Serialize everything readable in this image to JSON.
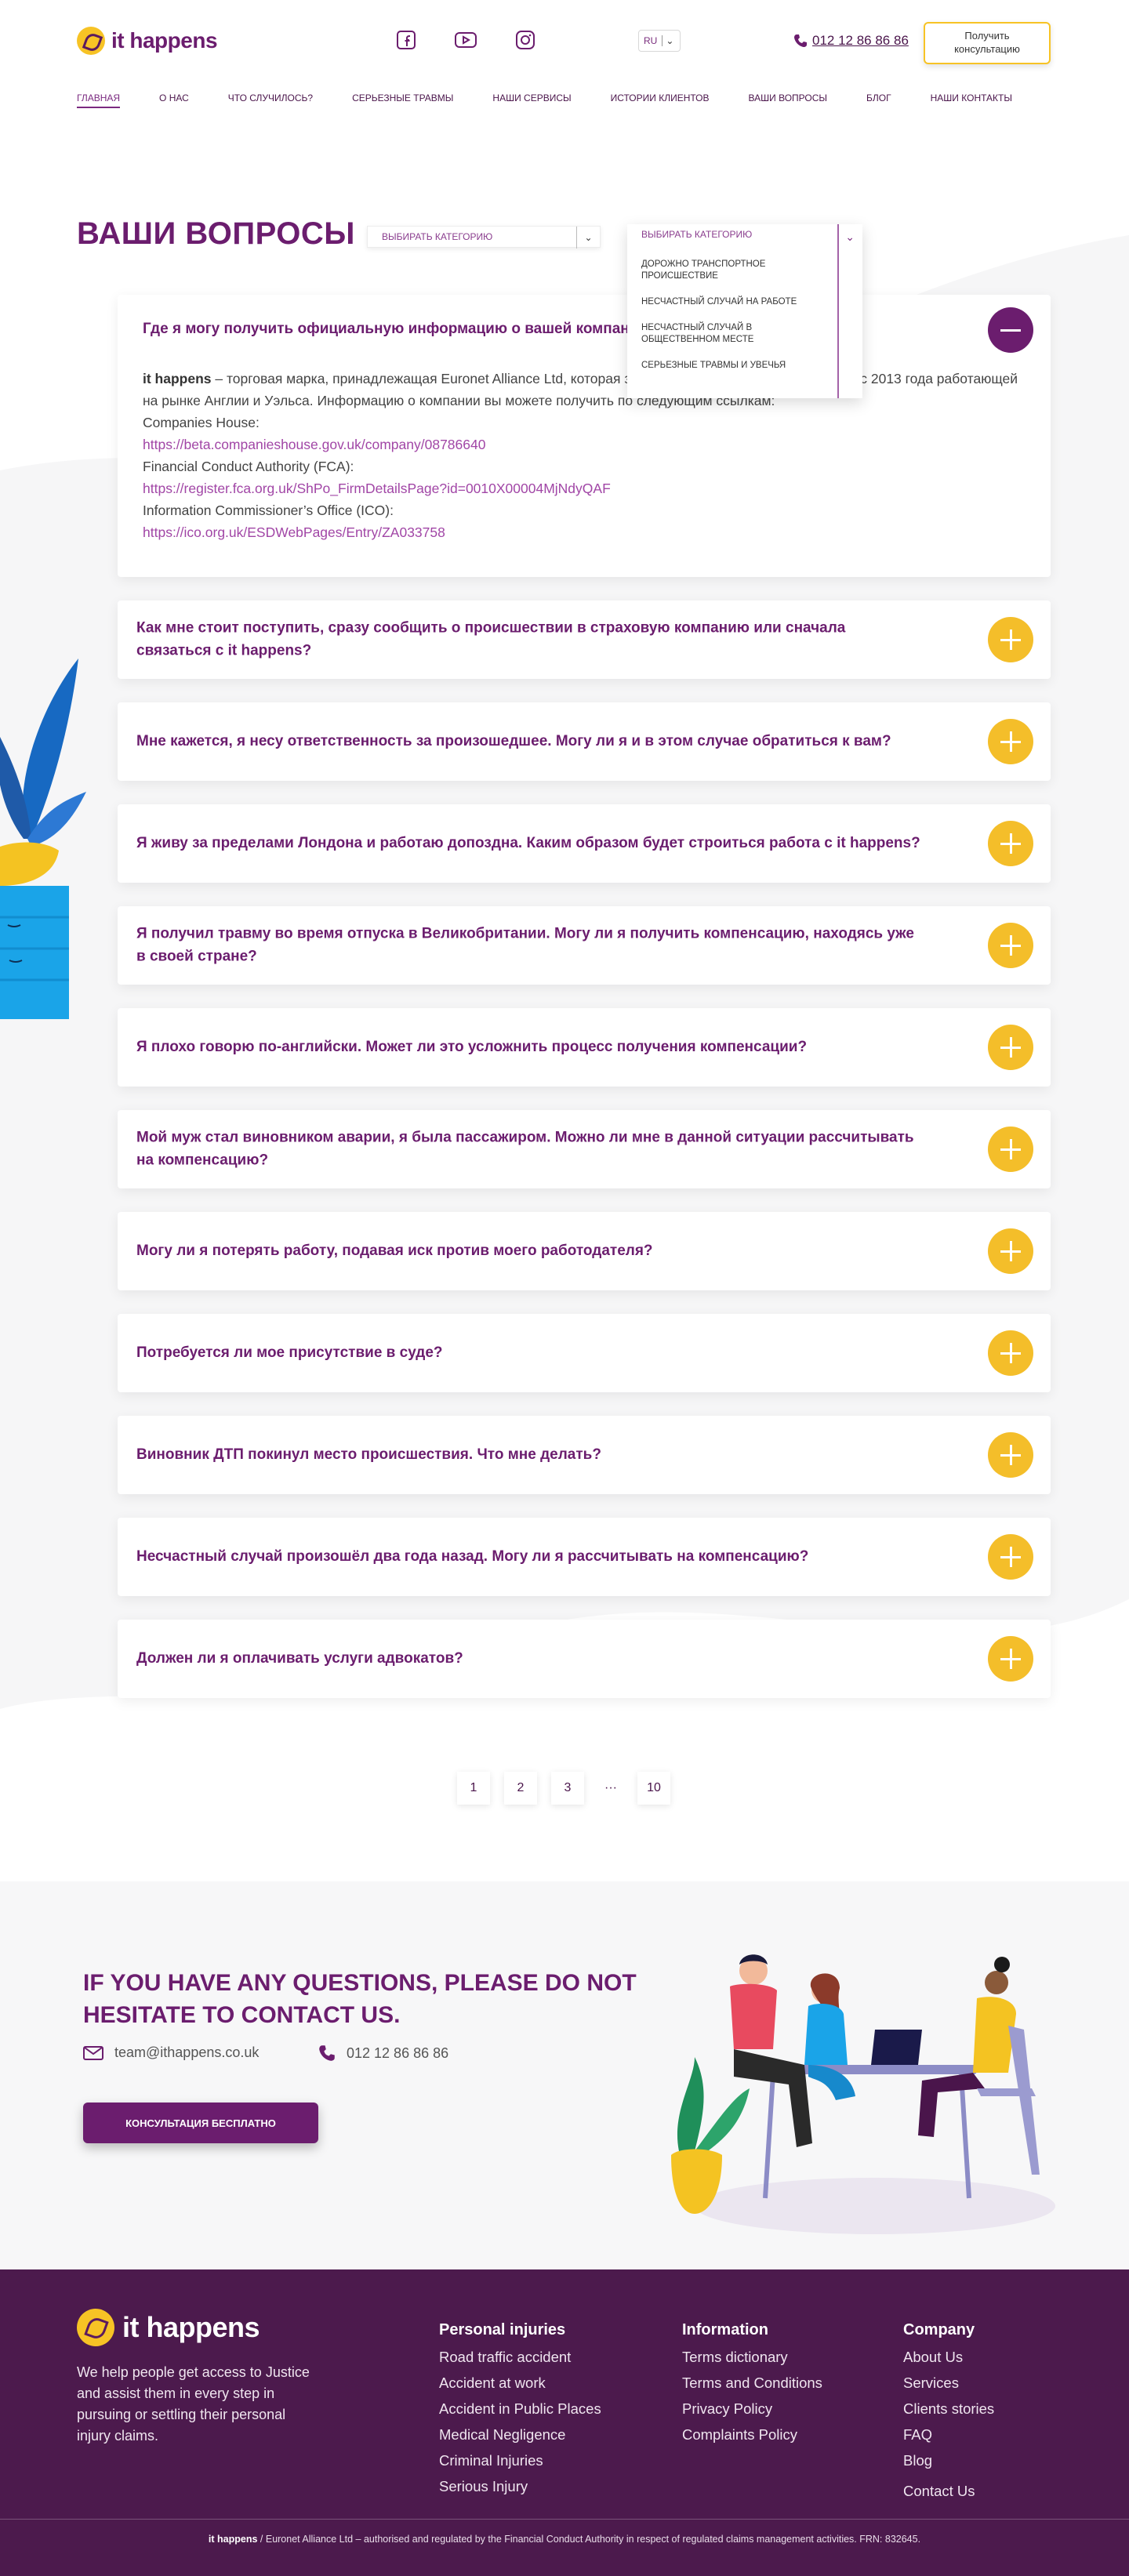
{
  "header": {
    "logo_text": "it happens",
    "language": "RU",
    "phone": "012 12 86 86 86",
    "cta_line1": "Получить",
    "cta_line2": "консультацию"
  },
  "nav": {
    "items": [
      "Главная",
      "О нас",
      "Что случилось?",
      "Серьезные травмы",
      "Наши сервисы",
      "Истории клиентов",
      "Ваши вопросы",
      "Блог",
      "Наши контакты"
    ]
  },
  "faq": {
    "title": "ВАШИ ВОПРОСЫ",
    "category_placeholder": "ВЫБИРАТЬ  КАТЕГОРИЮ",
    "dropdown": {
      "header": "ВЫБИРАТЬ  КАТЕГОРИЮ",
      "options": [
        "Дорожно транспортное происшествие",
        "Несчастный случай на работе",
        "Несчастный случай в общественном месте",
        "Серьезные травмы и увечья"
      ]
    },
    "open_question": "Где я могу получить официальную информацию о вашей компании?",
    "answer": {
      "brand": "it happens",
      "text1": " – торговая марка, принадлежащая Euronet Alliance Ltd, которая занимается юридическими рисками, с 2013 года работающей на рынке Англии и Уэльса. Информацию о компании вы можете получить по следующим ссылкам:",
      "label1": "Companies House:",
      "link1": "https://beta.companieshouse.gov.uk/company/08786640",
      "label2": "Financial Conduct Authority (FCA):",
      "link2": "https://register.fca.org.uk/ShPo_FirmDetailsPage?id=0010X00004MjNdyQAF",
      "label3": "Information Commissioner’s Office (ICO):",
      "link3": "https://ico.org.uk/ESDWebPages/Entry/ZA033758"
    },
    "questions": [
      "Как мне стоит поступить, сразу сообщить о происшествии в страховую компанию или сначала связаться с it happens?",
      "Мне кажется, я несу ответственность за произошедшее. Могу ли я и в этом случае обратиться к вам?",
      "Я живу за пределами Лондона и работаю допоздна. Каким образом будет строиться работа с it happens?",
      "Я получил травму во время отпуска в Великобритании. Могу ли я получить компенсацию, находясь уже в своей стране?",
      "Я плохо говорю по-английски. Может ли это усложнить процесс получения компенсации?",
      "Мой муж стал виновником аварии, я была пассажиром. Можно ли мне в данной ситуации рассчитывать на компенсацию?",
      "Могу ли я потерять работу, подавая иск против моего работодателя?",
      "Потребуется ли мое присутствие в суде?",
      "Виновник ДТП покинул место происшествия. Что мне делать?",
      "Несчастный случай произошёл два года назад. Могу ли я рассчитывать на компенсацию?",
      "Должен ли я оплачивать услуги адвокатов?"
    ]
  },
  "pagination": [
    "1",
    "2",
    "3",
    "···",
    "10"
  ],
  "contact": {
    "title": "IF YOU HAVE ANY QUESTIONS, PLEASE DO NOT HESITATE TO CONTACT US.",
    "email": "team@ithappens.co.uk",
    "phone": "012 12 86 86 86",
    "button": "Консультация бесплатно"
  },
  "footer": {
    "logo_text": "it happens",
    "about": "We help people get access to Justice and assist them in every step in pursuing or settling their personal injury claims.",
    "col1": {
      "title": "Personal injuries",
      "links": [
        "Road traffic accident",
        "Accident at work",
        "Accident in Public Places",
        "Medical Negligence",
        "Criminal Injuries",
        "Serious Injury"
      ]
    },
    "col2": {
      "title": "Information",
      "links": [
        "Terms dictionary",
        "Terms and Conditions",
        "Privacy Policy",
        "Complaints Policy"
      ]
    },
    "col3": {
      "title": "Company",
      "links": [
        "About Us",
        "Services",
        "Clients stories",
        "FAQ",
        "Blog",
        "Contact Us"
      ]
    },
    "legal_brand": "it happens",
    "legal_text": " / Euronet Alliance Ltd – authorised and regulated by the Financial Conduct Authority in respect of regulated claims management activities. FRN: 832645."
  },
  "colors": {
    "brand_purple": "#6b1d6e",
    "accent_yellow": "#f4be2a",
    "footer_bg": "#4c1a4d"
  }
}
